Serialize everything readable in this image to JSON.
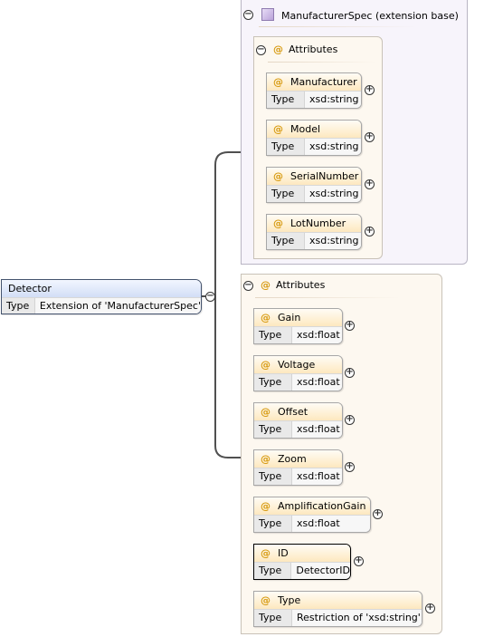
{
  "root": {
    "name": "Detector",
    "type_key": "Type",
    "type_value": "Extension of 'ManufacturerSpec'"
  },
  "base": {
    "title": "ManufacturerSpec (extension base)",
    "attributes_label": "Attributes",
    "attributes": [
      {
        "name": "Manufacturer",
        "type_key": "Type",
        "type_value": "xsd:string"
      },
      {
        "name": "Model",
        "type_key": "Type",
        "type_value": "xsd:string"
      },
      {
        "name": "SerialNumber",
        "type_key": "Type",
        "type_value": "xsd:string"
      },
      {
        "name": "LotNumber",
        "type_key": "Type",
        "type_value": "xsd:string"
      }
    ]
  },
  "own": {
    "attributes_label": "Attributes",
    "attributes": [
      {
        "name": "Gain",
        "type_key": "Type",
        "type_value": "xsd:float"
      },
      {
        "name": "Voltage",
        "type_key": "Type",
        "type_value": "xsd:float"
      },
      {
        "name": "Offset",
        "type_key": "Type",
        "type_value": "xsd:float"
      },
      {
        "name": "Zoom",
        "type_key": "Type",
        "type_value": "xsd:float"
      },
      {
        "name": "AmplificationGain",
        "type_key": "Type",
        "type_value": "xsd:float"
      },
      {
        "name": "ID",
        "type_key": "Type",
        "type_value": "DetectorID"
      },
      {
        "name": "Type",
        "type_key": "Type",
        "type_value": "Restriction of 'xsd:string'"
      }
    ]
  },
  "symbols": {
    "attribute": "@",
    "collapse": "−",
    "expand": "+"
  },
  "colors": {
    "attribute_icon": "#d79a10",
    "connector": "#505050",
    "root_border": "#44536d"
  }
}
